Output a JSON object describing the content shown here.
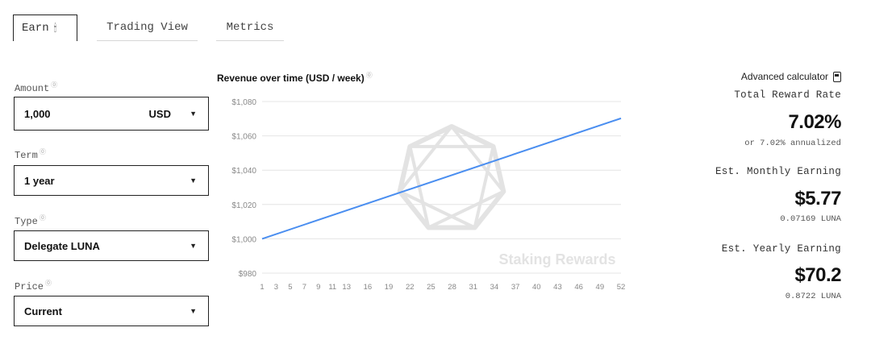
{
  "tabs": {
    "earn": "Earn",
    "trading_view": "Trading View",
    "metrics": "Metrics"
  },
  "form": {
    "amount_label": "Amount",
    "amount_value": "1,000",
    "amount_currency": "USD",
    "term_label": "Term",
    "term_value": "1 year",
    "type_label": "Type",
    "type_value": "Delegate LUNA",
    "price_label": "Price",
    "price_value": "Current"
  },
  "info_mark": "⓪",
  "chart_data": {
    "type": "line",
    "title": "Revenue over time (USD / week)",
    "x": [
      1,
      3,
      5,
      7,
      9,
      11,
      13,
      16,
      19,
      22,
      25,
      28,
      31,
      34,
      37,
      40,
      43,
      46,
      49,
      52
    ],
    "xlim": [
      1,
      52
    ],
    "ylim": [
      980,
      1080
    ],
    "yticks": [
      980,
      1000,
      1020,
      1040,
      1060,
      1080
    ],
    "ytick_labels": [
      "$980",
      "$1,000",
      "$1,020",
      "$1,040",
      "$1,060",
      "$1,080"
    ],
    "series": [
      {
        "values_x": [
          1,
          52
        ],
        "values_y": [
          1000,
          1070.2
        ],
        "color": "#4a8ef0"
      }
    ],
    "grid": "horizontal",
    "watermark": "Staking Rewards"
  },
  "metrics": {
    "advanced_calculator": "Advanced calculator",
    "total_reward_rate_label": "Total Reward Rate",
    "total_reward_rate_value": "7.02%",
    "total_reward_rate_sub": "or 7.02% annualized",
    "monthly_label": "Est. Monthly Earning",
    "monthly_value": "$5.77",
    "monthly_sub": "0.07169 LUNA",
    "yearly_label": "Est. Yearly Earning",
    "yearly_value": "$70.2",
    "yearly_sub": "0.8722 LUNA"
  },
  "colors": {
    "line": "#4a8ef0",
    "grid": "#e4e4e4",
    "watermark": "#e3e3e3"
  }
}
